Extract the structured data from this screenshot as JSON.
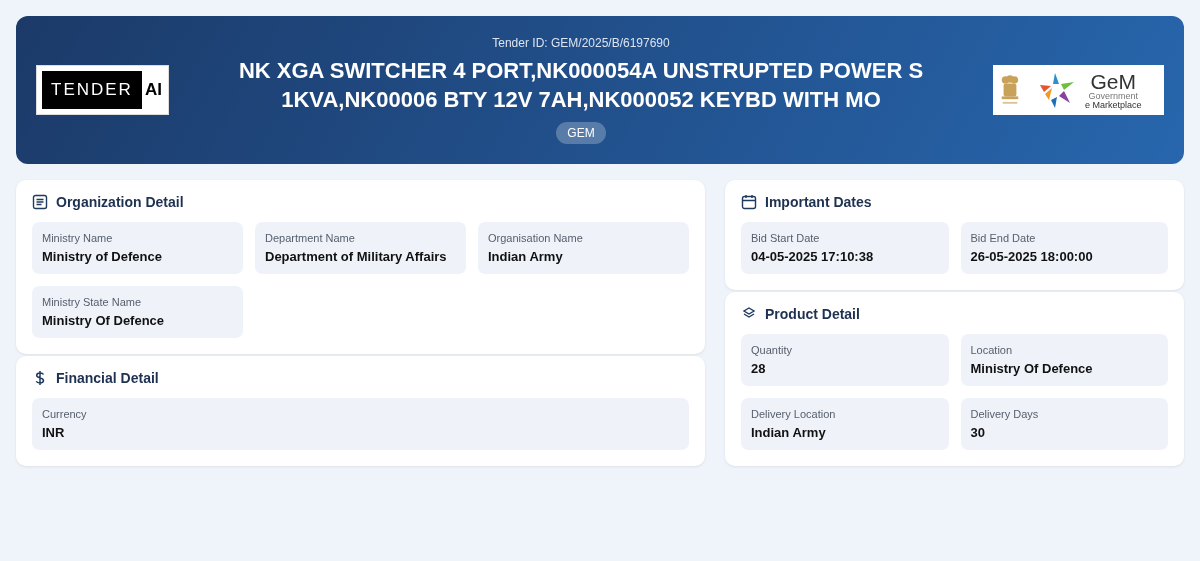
{
  "header": {
    "logo_left": {
      "word": "TENDER",
      "badge": "AI"
    },
    "tender_id": "Tender ID: GEM/2025/B/6197690",
    "title": "NK XGA SWITCHER 4 PORT,NK000054A UNSTRUPTED POWER S 1KVA,NK00006 BTY 12V 7AH,NK000052 KEYBD WITH MO",
    "tag": "GEM",
    "logo_right": {
      "name": "GeM",
      "line1": "Government",
      "line2": "e Marketplace"
    }
  },
  "columns": [
    [
      {
        "kind": "organization",
        "title": "Organization Detail",
        "fields": [
          {
            "label": "Ministry Name",
            "value": "Ministry of Defence"
          },
          {
            "label": "Department Name",
            "value": "Department of Military Affairs"
          },
          {
            "label": "Organisation Name",
            "value": "Indian Army"
          },
          {
            "label": "Ministry State Name",
            "value": "Ministry Of Defence"
          }
        ]
      },
      {
        "kind": "financial",
        "title": "Financial Detail",
        "fields": [
          {
            "label": "Currency",
            "value": "INR"
          }
        ]
      }
    ],
    [
      {
        "kind": "dates",
        "title": "Important Dates",
        "fields": [
          {
            "label": "Bid Start Date",
            "value": "04-05-2025 17:10:38"
          },
          {
            "label": "Bid End Date",
            "value": "26-05-2025 18:00:00"
          }
        ]
      },
      {
        "kind": "product",
        "title": "Product Detail",
        "fields": [
          {
            "label": "Quantity",
            "value": "28"
          },
          {
            "label": "Location",
            "value": "Ministry Of Defence"
          },
          {
            "label": "Delivery Location",
            "value": "Indian Army"
          },
          {
            "label": "Delivery Days",
            "value": "30"
          }
        ]
      }
    ]
  ]
}
